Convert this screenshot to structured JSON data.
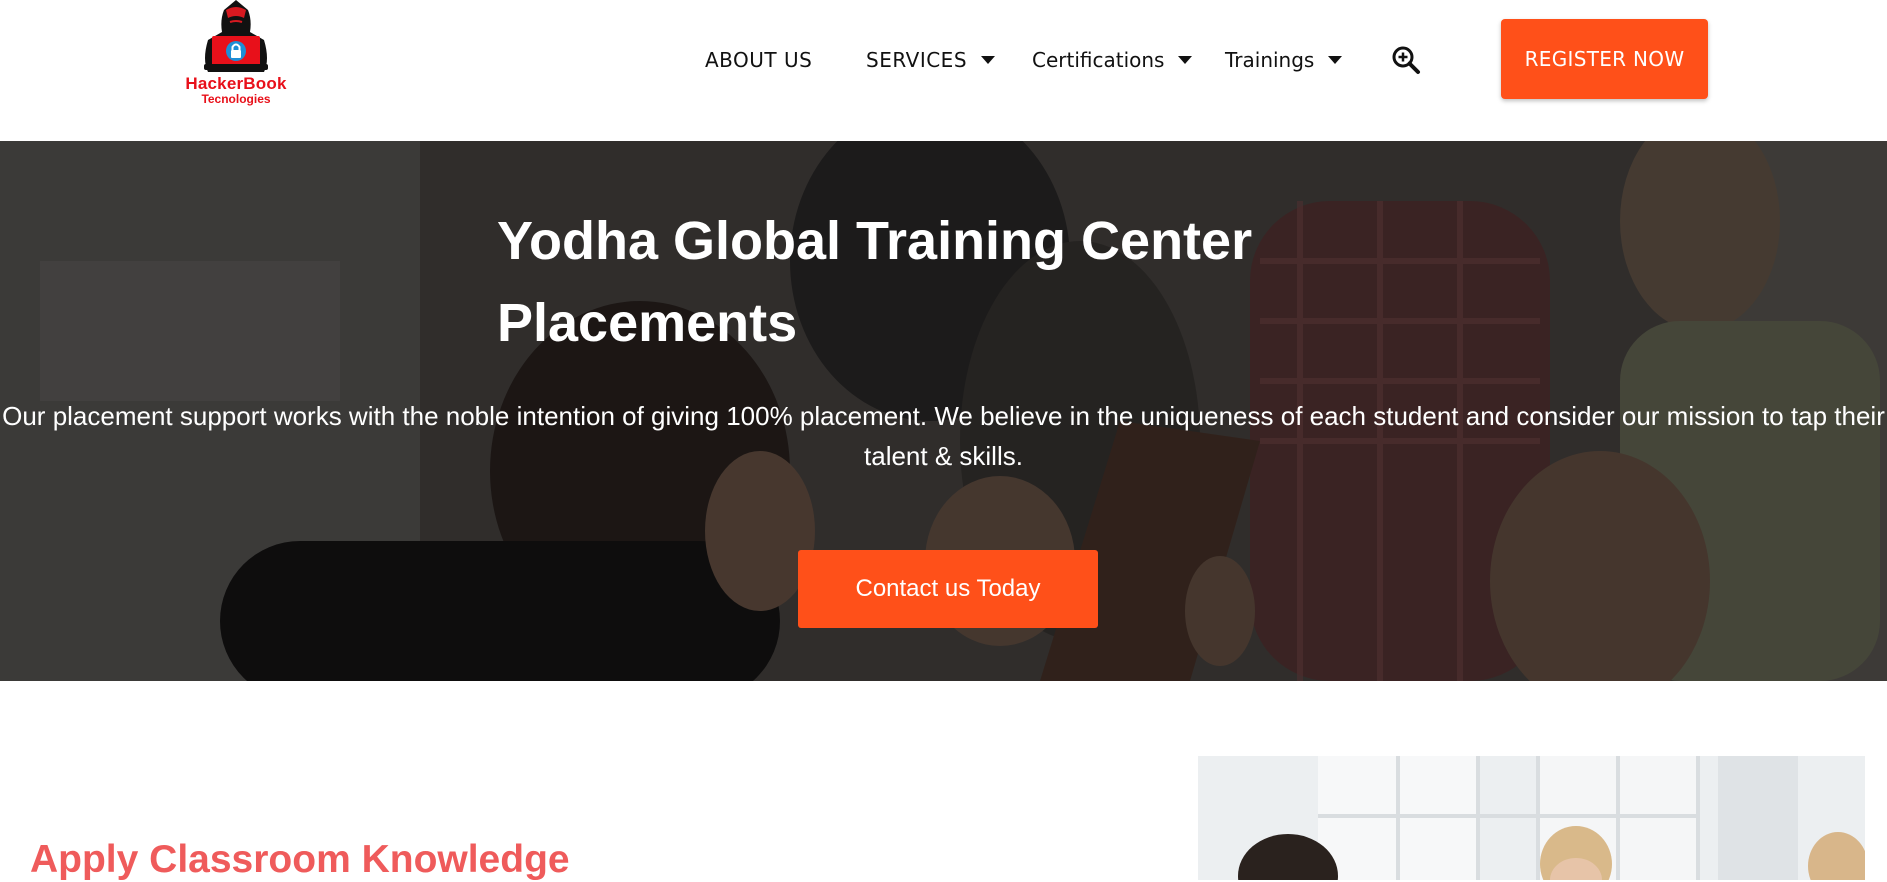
{
  "brand": {
    "name": "HackerBook",
    "tagline": "Tecnologies",
    "color": "#e8101a"
  },
  "nav": {
    "items": [
      {
        "label": "ABOUT US",
        "has_dropdown": false
      },
      {
        "label": "SERVICES",
        "has_dropdown": true
      },
      {
        "label": "Certifications",
        "has_dropdown": true
      },
      {
        "label": "Trainings",
        "has_dropdown": true
      }
    ],
    "search_icon": "zoom-in-search-icon",
    "register_label": "REGISTER NOW"
  },
  "hero": {
    "title": "Yodha Global Training Center Placements",
    "description": "Our placement support works with the noble intention of giving 100% placement. We believe in the uniqueness of each student and consider our mission to tap their talent & skills.",
    "cta_label": "Contact us Today"
  },
  "section": {
    "title": "Apply Classroom Knowledge"
  },
  "colors": {
    "accent": "#ff5019",
    "section_title": "#ef5b5b",
    "text": "#111111"
  }
}
